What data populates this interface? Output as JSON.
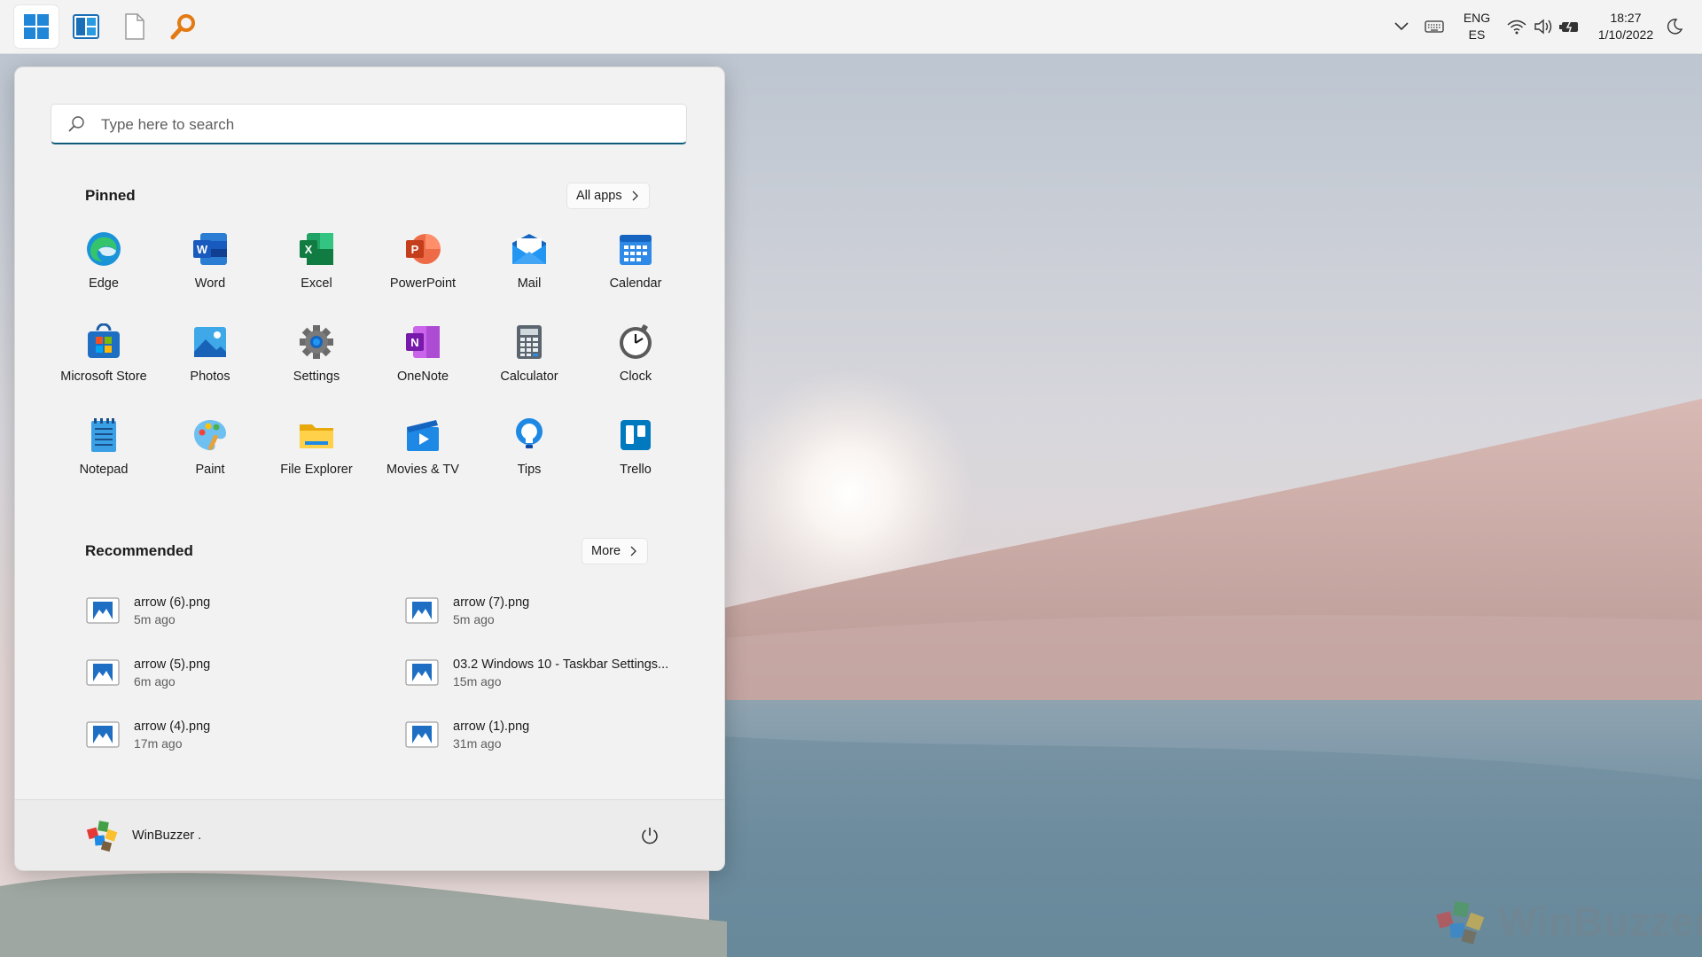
{
  "taskbar": {
    "buttons": [
      {
        "name": "start",
        "icon": "windows-logo-icon",
        "active": true
      },
      {
        "name": "widgets",
        "icon": "widgets-icon"
      },
      {
        "name": "blank-document",
        "icon": "document-icon"
      },
      {
        "name": "search",
        "icon": "magnifier-icon"
      }
    ],
    "tray": {
      "language_top": "ENG",
      "language_bottom": "ES",
      "time": "18:27",
      "date": "1/10/2022"
    }
  },
  "start_menu": {
    "search": {
      "placeholder": "Type here to search"
    },
    "pinned": {
      "title": "Pinned",
      "all_apps_label": "All apps",
      "apps": [
        {
          "label": "Edge",
          "icon": "edge-icon"
        },
        {
          "label": "Word",
          "icon": "word-icon"
        },
        {
          "label": "Excel",
          "icon": "excel-icon"
        },
        {
          "label": "PowerPoint",
          "icon": "powerpoint-icon"
        },
        {
          "label": "Mail",
          "icon": "mail-icon"
        },
        {
          "label": "Calendar",
          "icon": "calendar-icon"
        },
        {
          "label": "Microsoft Store",
          "icon": "store-icon"
        },
        {
          "label": "Photos",
          "icon": "photos-icon"
        },
        {
          "label": "Settings",
          "icon": "gear-icon"
        },
        {
          "label": "OneNote",
          "icon": "onenote-icon"
        },
        {
          "label": "Calculator",
          "icon": "calculator-icon"
        },
        {
          "label": "Clock",
          "icon": "clock-icon"
        },
        {
          "label": "Notepad",
          "icon": "notepad-icon"
        },
        {
          "label": "Paint",
          "icon": "paint-icon"
        },
        {
          "label": "File Explorer",
          "icon": "folder-icon"
        },
        {
          "label": "Movies & TV",
          "icon": "movies-icon"
        },
        {
          "label": "Tips",
          "icon": "lightbulb-icon"
        },
        {
          "label": "Trello",
          "icon": "trello-icon"
        }
      ]
    },
    "recommended": {
      "title": "Recommended",
      "more_label": "More",
      "items": [
        {
          "name": "arrow (6).png",
          "time": "5m ago"
        },
        {
          "name": "arrow (7).png",
          "time": "5m ago"
        },
        {
          "name": "arrow (5).png",
          "time": "6m ago"
        },
        {
          "name": "03.2 Windows 10 - Taskbar Settings...",
          "time": "15m ago"
        },
        {
          "name": "arrow (4).png",
          "time": "17m ago"
        },
        {
          "name": "arrow (1).png",
          "time": "31m ago"
        }
      ]
    },
    "user": {
      "name": "WinBuzzer ."
    }
  },
  "watermark": {
    "text": "WinBuzzer"
  },
  "colors": {
    "accent": "#0e5b7a",
    "panel": "#f2f2f2",
    "taskbar": "#f3f3f3"
  }
}
